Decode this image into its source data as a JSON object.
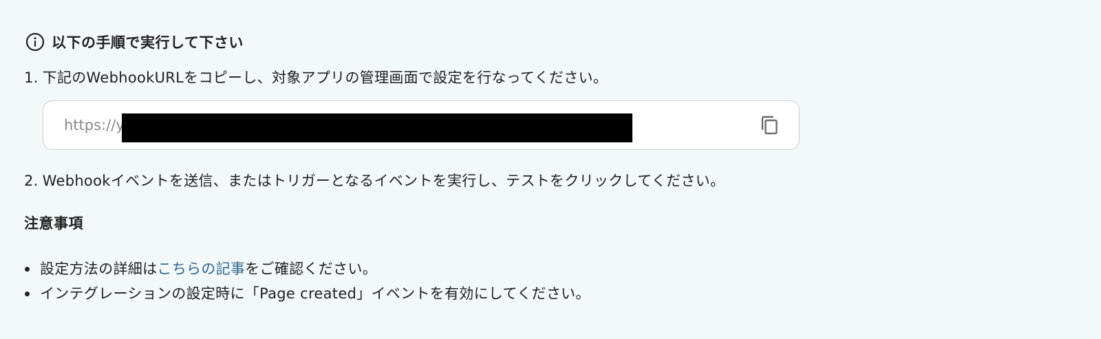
{
  "instructions": {
    "heading": "以下の手順で実行して下さい",
    "step1": {
      "number": "1.",
      "text": "下記のWebhookURLをコピーし、対象アプリの管理画面で設定を行なってください。"
    },
    "webhook_url": {
      "visible_text": "https://y"
    },
    "step2": {
      "number": "2.",
      "text": "Webhookイベントを送信、またはトリガーとなるイベントを実行し、テストをクリックしてください。"
    }
  },
  "notes": {
    "title": "注意事項",
    "item1": {
      "prefix": "設定方法の詳細は",
      "link_text": "こちらの記事",
      "suffix": "をご確認ください。"
    },
    "item2": {
      "text": "インテグレーションの設定時に「Page created」イベントを有効にしてください。"
    }
  },
  "colors": {
    "background": "#f3f8f9",
    "link": "#2f6690",
    "text": "#1f1f1f"
  },
  "icons": {
    "heading_icon": "info-circle-icon",
    "copy_icon": "copy-icon"
  }
}
